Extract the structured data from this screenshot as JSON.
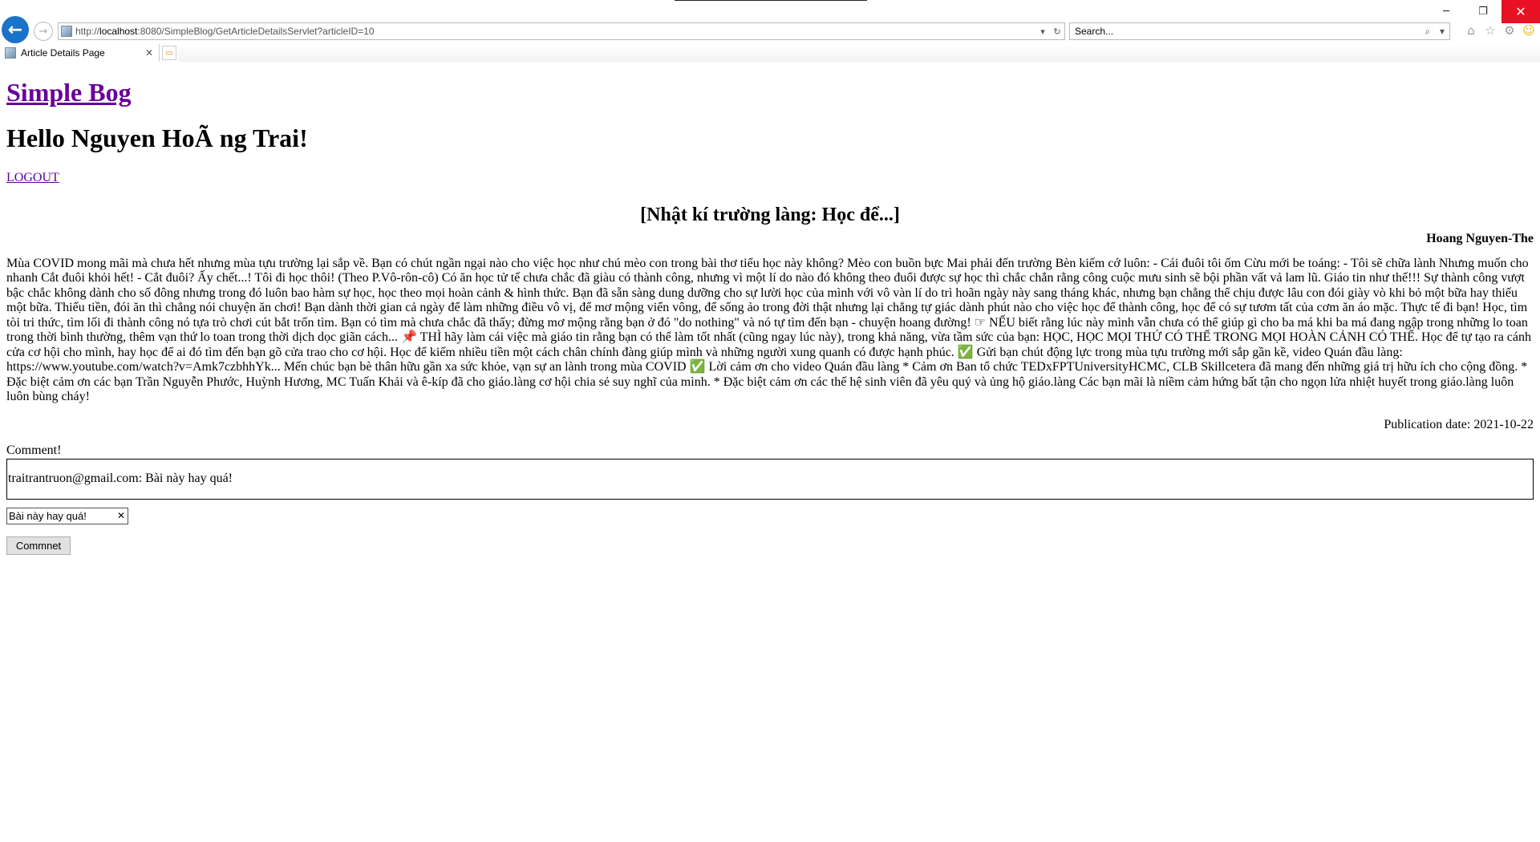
{
  "browser": {
    "window_controls": {
      "minimize": "─",
      "restore": "❐",
      "close": "✕"
    },
    "back_icon": "←",
    "forward_icon": "→",
    "url_prefix": "http://",
    "url_host": "localhost",
    "url_rest": ":8080/SimpleBlog/GetArticleDetailsServlet?articleID=10",
    "search_placeholder": "Search...",
    "tab_title": "Article Details Page",
    "tab_close": "✕",
    "address_icons": {
      "dropdown": "▾",
      "refresh": "↻"
    },
    "search_icons": {
      "search": "⌕",
      "dropdown": "▾"
    },
    "tools": {
      "home": "⌂",
      "favorites": "☆",
      "settings": "⚙",
      "feedback": "☺"
    }
  },
  "page": {
    "site_title": "Simple Bog",
    "greeting": "Hello Nguyen HoÃ ng Trai!",
    "logout": "LOGOUT",
    "article": {
      "title": "[Nhật kí trường làng: Học để...]",
      "author": "Hoang Nguyen-The",
      "body": "Mùa COVID mong mãi mà chưa hết nhưng mùa tựu trường lại sắp về. Bạn có chút ngần ngại nào cho việc học như chú mèo con trong bài thơ tiểu học này không? Mèo con buồn bực Mai phải đến trường Bèn kiếm cớ luôn: - Cái đuôi tôi ốm Cừu mới be toáng: - Tôi sẽ chữa lành Nhưng muốn cho nhanh Cắt đuôi khỏi hết! - Cắt đuôi? Ấy chết...! Tôi đi học thôi! (Theo P.Vô-rôn-cô) Có ăn học tử tế chưa chắc đã giàu có thành công, nhưng vì một lí do nào đó không theo đuổi được sự học thì chắc chắn rằng công cuộc mưu sinh sẽ bội phần vất vả lam lũ. Giáo tin như thế!!! Sự thành công vượt bậc chắc không dành cho số đông nhưng trong đó luôn bao hàm sự học, học theo mọi hoàn cảnh & hình thức. Bạn đã sẵn sàng dung dưỡng cho sự lười học của mình với vô vàn lí do trì hoãn ngày này sang tháng khác, nhưng bạn chẳng thể chịu được lâu con đói giày vò khi bỏ một bữa hay thiếu một bữa. Thiếu tiền, đói ăn thì chẳng nói chuyện ăn chơi! Bạn dành thời gian cả ngày để làm những điều vô vị, để mơ mộng viển vông, để sống ảo trong đời thật nhưng lại chẳng tự giác dành phút nào cho việc học để thành công, học để có sự tươm tất của cơm ăn áo mặc. Thực tế đi bạn! Học, tìm tòi tri thức, tìm lối đi thành công nó tựa trò chơi cút bắt trốn tìm. Bạn có tìm mà chưa chắc đã thấy; đừng mơ mộng rằng bạn ở đó \"do nothing\" và nó tự tìm đến bạn - chuyện hoang đường! ☞ NẾU biết rằng lúc này mình vẫn chưa có thể giúp gì cho ba má khi ba má đang ngập trong những lo toan trong thời bình thường, thêm vạn thứ lo toan trong thời dịch dọc giãn cách... 📌 THÌ hãy làm cái việc mà giáo tin rằng bạn có thể làm tốt nhất (cũng ngay lúc này), trong khả năng, vừa tầm sức của bạn: HỌC, HỌC MỌI THỨ CÓ THỂ TRONG MỌI HOÀN CẢNH CÓ THỂ. Học để tự tạo ra cánh cửa cơ hội cho mình, hay học để ai đó tìm đến bạn gõ cửa trao cho cơ hội. Học để kiếm nhiều tiền một cách chân chính đàng giúp mình và những người xung quanh có được hạnh phúc. ✅ Gửi bạn chút động lực trong mùa tựu trường mới sắp gần kề, video Quán đầu làng: https://www.youtube.com/watch?v=Amk7czbhhYk... Mến chúc bạn bè thân hữu gần xa sức khỏe, vạn sự an lành trong mùa COVID ✅ Lời cảm ơn cho video Quán đầu làng * Cảm ơn Ban tổ chức TEDxFPTUniversityHCMC, CLB Skillcetera đã mang đến những giá trị hữu ích cho cộng đồng. * Đặc biệt cảm ơn các bạn Trần Nguyễn Phước, Huỳnh Hương, MC Tuấn Khải và ê-kíp đã cho giáo.làng cơ hội chia sẻ suy nghĩ của mình. * Đặc biệt cảm ơn các thế hệ sinh viên đã yêu quý và ủng hộ giáo.làng Các bạn mãi là niềm cảm hứng bất tận cho ngọn lửa nhiệt huyết trong giáo.làng luôn luôn bùng cháy!",
      "publication_label": "Publication date: ",
      "publication_date": "2021-10-22"
    },
    "comments": {
      "label": "Comment!",
      "items": [
        {
          "author": "traitrantruon@gmail.com",
          "text": "Bài này hay quá!"
        }
      ],
      "input_value": "Bài này hay quá!",
      "clear_icon": "✕",
      "submit_label": "Commnet"
    }
  }
}
